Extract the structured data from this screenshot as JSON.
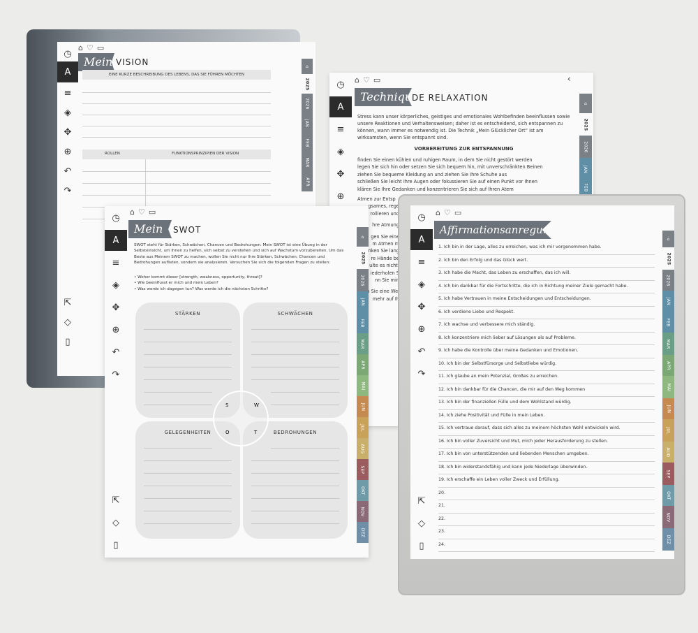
{
  "toolbar_icons": [
    "clock-icon",
    "pen-icon",
    "menu-lines-icon",
    "eraser-icon",
    "move-icon",
    "zoom-icon",
    "undo-icon",
    "redo-icon"
  ],
  "bottom_icons": [
    "share-icon",
    "layers-icon",
    "notebook-icon"
  ],
  "tabs": {
    "year": "2025",
    "next_year": "2026",
    "months": [
      "JAN",
      "FEB",
      "MAR",
      "APR",
      "MAI",
      "JUN",
      "JUL",
      "AUG",
      "SEP",
      "OKT",
      "NOV",
      "DEZ"
    ],
    "colors": [
      "#5f8fa6",
      "#5f8fa6",
      "#6a9e86",
      "#7ca876",
      "#8fb780",
      "#c48a4f",
      "#c9a25a",
      "#c9b06a",
      "#9a5c5e",
      "#6f9aa8",
      "#8b6a78",
      "#6f8ea8"
    ]
  },
  "vision": {
    "banner": "Meine",
    "title": "VISION",
    "subtitle": "EINE KURZE BESCHREIBUNG DES LEBENS, DAS SIE FÜHREN MÖCHTEN",
    "col_roles": "ROLLEN",
    "col_principles": "FUNKTIONSPRINZIPIEN DER VISION"
  },
  "relaxation": {
    "banner": "Techniques",
    "title": "DE RELAXATION",
    "intro": "Stress kann unser körperliches, geistiges und emotionales Wohlbefinden beeinflussen sowie unsere Reaktionen und Verhaltensweisen; daher ist es entscheidend, sich entspannen zu können, wann immer es notwendig ist. Die Technik „Mein Glücklicher Ort“ ist am wirksamsten, wenn Sie entspannt sind.",
    "heading": "VORBEREITUNG ZUR ENTSPANNUNG",
    "bullets": [
      "finden Sie einen kühlen und ruhigen Raum, in dem Sie nicht gestört werden",
      "legen Sie sich hin oder setzen Sie sich bequem hin, mit unverschränkten Beinen",
      "ziehen Sie bequeme Kleidung an und ziehen Sie Ihre Schuhe aus",
      "schließen Sie leicht Ihre Augen oder fokussieren Sie auf einen Punkt vor Ihnen",
      "klären Sie Ihre Gedanken und konzentrieren Sie sich auf Ihren Atem"
    ],
    "fragments": [
      "Atmen zur Entsp",
      "gsames, rege",
      "rollieren und",
      "hre Atmung",
      "gen Sie eine",
      "m Atmen m",
      "nken Sie lang",
      "re Hände be",
      "ulte es nicht.",
      "iederholen S",
      "nn Sie min",
      "hen Sie eine Wei",
      "mehr auf Ih"
    ]
  },
  "swot": {
    "banner": "Mein",
    "title": "SWOT",
    "intro": "SWOT steht für Stärken, Schwächen, Chancen und Bedrohungen. Mein SWOT ist eine Übung in der Selbsteinsicht, um Ihnen zu helfen, sich selbst zu verstehen und sich auf Wachstum vorzubereiten. Um das Beste aus Meinem SWOT zu machen, wollen Sie nicht nur Ihre Stärken, Schwächen, Chancen und Bedrohungen auflisten, sondern sie analysieren. Versuchen Sie sich die folgenden Fragen zu stellen:",
    "questions": [
      "• Woher kommt dieser [strength, weakness, opportunity, threat]?",
      "• Wie beeinflusst er mich und mein Leben?",
      "• Was werde ich dagegen tun? Was werde ich die nächsten Schritte?"
    ],
    "q_strengths": "STÄRKEN",
    "q_weaknesses": "SCHWÄCHEN",
    "q_opportunities": "GELEGENHEITEN",
    "q_threats": "BEDROHUNGEN",
    "letters": [
      "S",
      "W",
      "O",
      "T"
    ]
  },
  "affirmations": {
    "banner": "Affirmationsanregungen",
    "items": [
      "1. Ich bin in der Lage, alles zu erreichen, was ich mir vorgenommen habe.",
      "2. Ich bin den Erfolg und das Glück wert.",
      "3. Ich habe die Macht, das Leben zu erschaffen, das ich will.",
      "4. Ich bin dankbar für die Fortschritte, die ich in Richtung meiner Ziele gemacht habe.",
      "5. Ich habe Vertrauen in meine Entscheidungen und Entscheidungen.",
      "6. Ich verdiene Liebe und Respekt.",
      "7. Ich wachse und verbessere mich ständig.",
      "8. Ich konzentriere mich lieber auf Lösungen als auf Probleme.",
      "9. Ich habe die Kontrolle über meine Gedanken und Emotionen.",
      "10. Ich bin der Selbstfürsorge und Selbstliebe würdig.",
      "11. Ich glaube an mein Potenzial, Großes zu erreichen.",
      "12. Ich bin dankbar für die Chancen, die mir auf den Weg kommen",
      "13. Ich bin der finanziellen Fülle und dem Wohlstand würdig.",
      "14. Ich ziehe Positivität und Fülle in mein Leben.",
      "15. Ich vertraue darauf, dass sich alles zu meinem höchsten Wohl entwickeln wird.",
      "16. Ich bin voller Zuversicht und Mut, mich jeder Herausforderung zu stellen.",
      "17. Ich bin von unterstützenden und liebenden Menschen umgeben.",
      "18. Ich bin widerstandsfähig und kann jede Niederlage überwinden.",
      "19. Ich erschaffe ein Leben voller Zweck und Erfüllung.",
      "20.",
      "21.",
      "22.",
      "23.",
      "24."
    ]
  }
}
